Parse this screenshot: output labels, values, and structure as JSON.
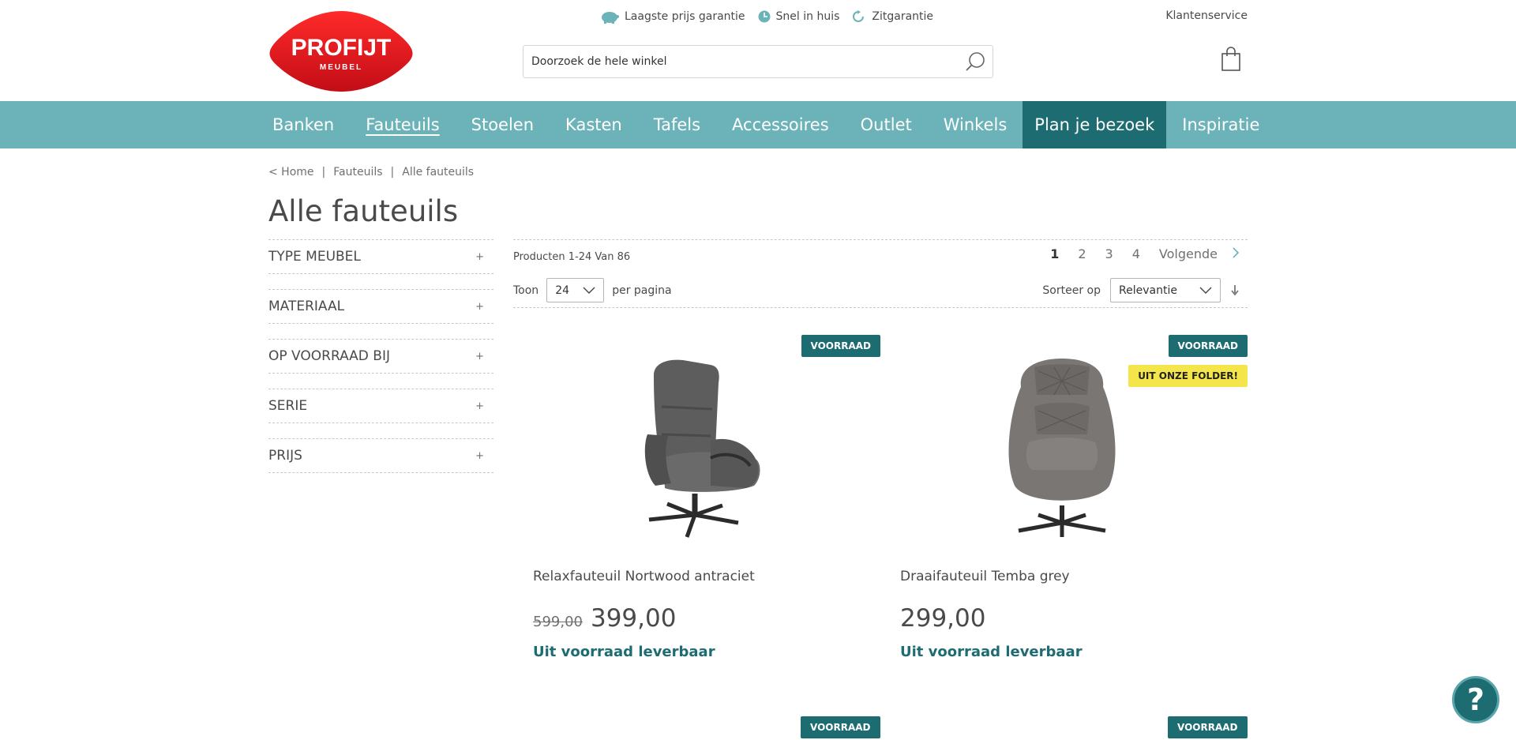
{
  "header": {
    "logo_text": "PROFIJT",
    "logo_subtext": "MEUBEL",
    "usps": [
      {
        "icon": "piggy-bank-icon",
        "label": "Laagste prijs garantie"
      },
      {
        "icon": "clock-icon",
        "label": "Snel in huis"
      },
      {
        "icon": "refresh-icon",
        "label": "Zitgarantie"
      }
    ],
    "customer_service": "Klantenservice",
    "search_placeholder": "Doorzoek de hele winkel"
  },
  "nav": {
    "items": [
      "Banken",
      "Fauteuils",
      "Stoelen",
      "Kasten",
      "Tafels",
      "Accessoires",
      "Outlet",
      "Winkels",
      "Plan je bezoek",
      "Inspiratie"
    ],
    "active": "Fauteuils",
    "highlight": "Plan je bezoek"
  },
  "breadcrumb": {
    "home": "< Home",
    "sep": "|",
    "category": "Fauteuils",
    "current": "Alle fauteuils"
  },
  "page_title": "Alle fauteuils",
  "filters": [
    {
      "label": "TYPE MEUBEL",
      "toggle": "+"
    },
    {
      "label": "MATERIAAL",
      "toggle": "+"
    },
    {
      "label": "OP VOORRAAD BIJ",
      "toggle": "+"
    },
    {
      "label": "SERIE",
      "toggle": "+"
    },
    {
      "label": "PRIJS",
      "toggle": "+"
    }
  ],
  "toolbar": {
    "count": "Producten 1-24 Van 86",
    "pages": [
      "1",
      "2",
      "3",
      "4"
    ],
    "current_page": "1",
    "next_label": "Volgende",
    "show_label": "Toon",
    "per_page_value": "24",
    "per_page_label": "per pagina",
    "sort_label": "Sorteer op",
    "sort_value": "Relevantie"
  },
  "products": [
    {
      "name": "Relaxfauteuil Nortwood antraciet",
      "old_price": "599,00",
      "price": "399,00",
      "availability": "Uit voorraad leverbaar",
      "badges": [
        "VOORRAAD"
      ]
    },
    {
      "name": "Draaifauteuil Temba grey",
      "old_price": "",
      "price": "299,00",
      "availability": "Uit voorraad leverbaar",
      "badges": [
        "VOORRAAD",
        "UIT ONZE FOLDER!"
      ]
    }
  ],
  "next_row_badges": [
    "VOORRAAD",
    "VOORRAAD"
  ],
  "colors": {
    "brand_red": "#d8141c",
    "nav_teal": "#6cb3b9",
    "dark_teal": "#1c6c72",
    "folder_yellow": "#f4e64a"
  },
  "help_label": "?"
}
